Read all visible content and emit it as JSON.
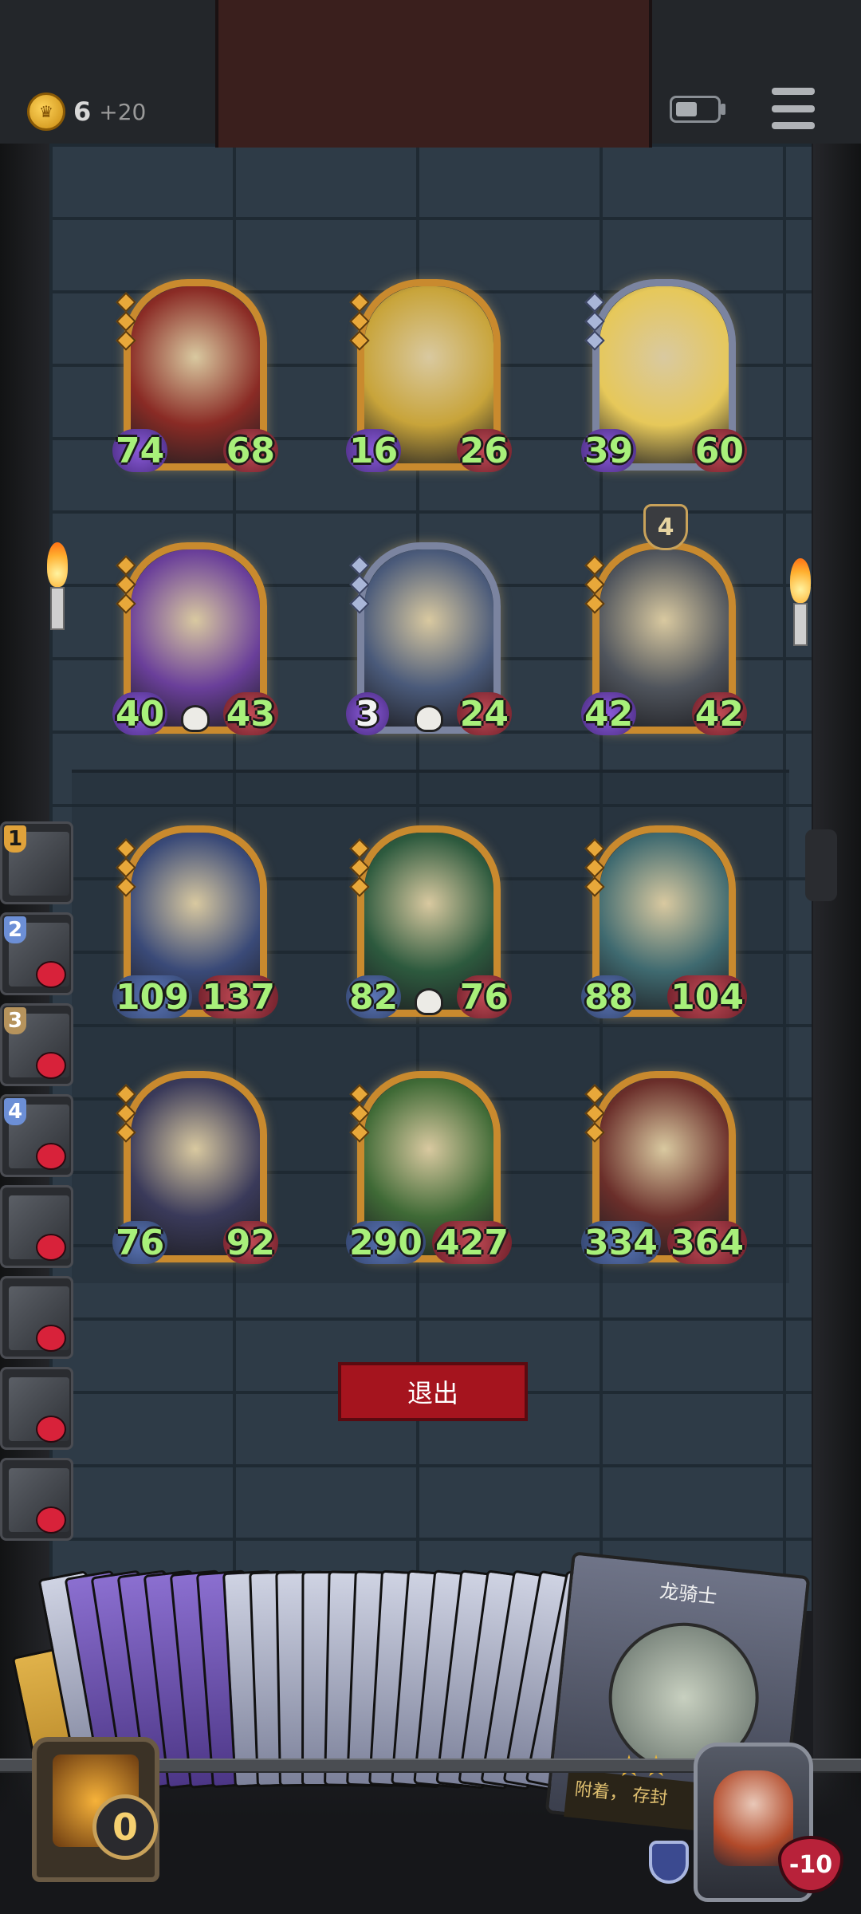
{
  "status": {
    "gold": "6",
    "gold_income": "+20"
  },
  "board": {
    "enemy_row1": [
      {
        "atk": "74",
        "hp": "68",
        "frame": "gold",
        "atk_color": "purple",
        "art": "red-dragon",
        "art_color": "#8a2b25"
      },
      {
        "atk": "16",
        "hp": "26",
        "frame": "gold",
        "atk_color": "purple",
        "art": "bird-mummy",
        "art_color": "#c8a43a"
      },
      {
        "atk": "39",
        "hp": "60",
        "frame": "silver",
        "atk_color": "purple",
        "art": "bearded-warrior",
        "art_color": "#e6c85a"
      }
    ],
    "enemy_row2": [
      {
        "atk": "40",
        "hp": "43",
        "frame": "gold",
        "atk_color": "purple",
        "art": "golden-dragon",
        "art_color": "#6a3f9a",
        "skull": true
      },
      {
        "atk": "3",
        "hp": "24",
        "frame": "silver",
        "atk_color": "purple",
        "art": "dark-beast",
        "art_color": "#4a5a7a",
        "skull": true,
        "atk_white": true
      },
      {
        "atk": "42",
        "hp": "42",
        "frame": "gold",
        "atk_color": "purple",
        "art": "shield-knight",
        "art_color": "#4f545c",
        "badge": "4"
      }
    ],
    "player_row1": [
      {
        "atk": "109",
        "hp": "137",
        "frame": "gold",
        "atk_color": "blue",
        "art": "armored-knight",
        "art_color": "#3a4a78"
      },
      {
        "atk": "82",
        "hp": "76",
        "frame": "gold",
        "atk_color": "blue",
        "art": "vine-heart",
        "art_color": "#2d5a3e",
        "skull": true
      },
      {
        "atk": "88",
        "hp": "104",
        "frame": "gold",
        "atk_color": "blue",
        "art": "stone-golem",
        "art_color": "#3f6a70"
      }
    ],
    "player_row2": [
      {
        "atk": "76",
        "hp": "92",
        "frame": "gold",
        "atk_color": "blue",
        "art": "blue-elf",
        "art_color": "#3a3a5a"
      },
      {
        "atk": "290",
        "hp": "427",
        "frame": "gold",
        "atk_color": "blue",
        "art": "leaf-sprout",
        "art_color": "#3f6a36"
      },
      {
        "atk": "334",
        "hp": "364",
        "frame": "gold",
        "atk_color": "blue",
        "art": "red-serpent",
        "art_color": "#6a2e2a"
      }
    ]
  },
  "sidebar": {
    "items": [
      {
        "num": "1",
        "num_color": "gold",
        "dead": false
      },
      {
        "num": "2",
        "num_color": "blue",
        "dead": true
      },
      {
        "num": "3",
        "num_color": "tan",
        "dead": true
      },
      {
        "num": "4",
        "num_color": "blue",
        "dead": true
      },
      {
        "num": "",
        "dead": true
      },
      {
        "num": "",
        "dead": true
      },
      {
        "num": "",
        "dead": true
      },
      {
        "num": "",
        "dead": true
      }
    ]
  },
  "actions": {
    "exit_label": "退出"
  },
  "hand": {
    "top_card_name": "龙骑士",
    "top_card_desc": "附着，\n存封",
    "energy": "0"
  },
  "hero": {
    "hp": "-10"
  }
}
